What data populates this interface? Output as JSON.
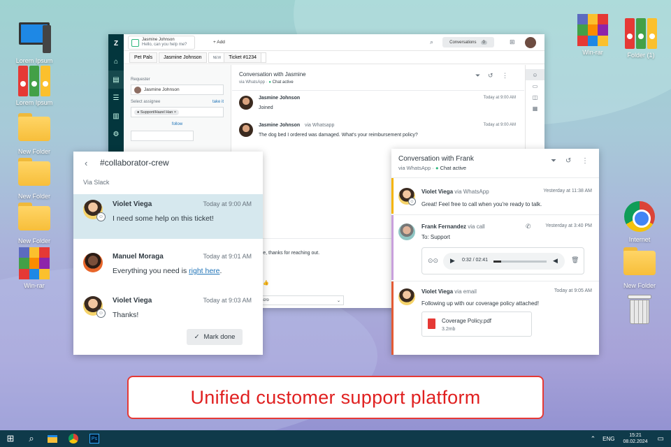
{
  "desktop": {
    "left_icons": [
      "Lorem Ipsum",
      "Lorem Ipsum",
      "New Folder",
      "New Folder",
      "New Folder",
      "Win-rar"
    ],
    "right_icons": [
      "Win-rar",
      "Folder (1)",
      "Internet",
      "New Folder"
    ]
  },
  "app": {
    "topbar": {
      "requester_name": "Jasmine Johnson",
      "requester_msg": "Hello, can you help me?",
      "add_label": "+ Add",
      "conversations_label": "Conversations",
      "conversations_count": "0"
    },
    "tabs": [
      "Pet Pals",
      "Jasmine Johnson"
    ],
    "ticket_tag": "NEW",
    "ticket_label": "Ticket #1234",
    "left": {
      "requester_label": "Requester",
      "requester_value": "Jasmine Johnson",
      "assignee_label": "Select assignee",
      "take_it": "take it",
      "assignee_value": "Support/Hazel Han",
      "follow": "follow"
    },
    "conversation": {
      "title": "Conversation with Jasmine",
      "via": "via WhatsApp",
      "status": "Chat active",
      "messages": [
        {
          "name": "Jasmine Johnson",
          "via": "",
          "time": "Today at 9:00 AM",
          "text": "Joined"
        },
        {
          "name": "Jasmine Johnson",
          "via": "via Whatsapp",
          "time": "Today at 9:00 AM",
          "text": "The dog bed I ordered was damaged. What's your reimbursement policy?"
        }
      ],
      "reply_fragment": "ere, thanks for reaching out.",
      "macro_fragment": "acro"
    }
  },
  "slack": {
    "channel": "#collaborator-crew",
    "via": "Via Slack",
    "messages": [
      {
        "name": "Violet Viega",
        "time": "Today at 9:00 AM",
        "text": "I need some help on this ticket!"
      },
      {
        "name": "Manuel Moraga",
        "time": "Today at 9:01 AM",
        "text_before": "Everything you need is ",
        "link": "right here",
        "text_after": "."
      },
      {
        "name": "Violet Viega",
        "time": "Today at 9:03 AM",
        "text": "Thanks!"
      }
    ],
    "mark_done": "Mark done"
  },
  "frank": {
    "title": "Conversation with Frank",
    "via": "via WhatsApp",
    "status": "Chat active",
    "items": [
      {
        "name": "Violet Viega",
        "via": "via WhatsApp",
        "time": "Yesterday at 11:38 AM",
        "text": "Great! Feel free to call when you're ready to talk."
      },
      {
        "name": "Frank Fernandez",
        "via": "via call",
        "time": "Yesterday at 3:40 PM",
        "text": "To: Support",
        "audio": "0:32 / 02:41"
      },
      {
        "name": "Violet Viega",
        "via": "via email",
        "time": "Today at 9:05 AM",
        "text": "Following up with our coverage policy attached!",
        "file_name": "Coverage Policy.pdf",
        "file_size": "3.2mb"
      }
    ]
  },
  "banner": "Unified customer support platform",
  "taskbar": {
    "lang": "ENG",
    "time": "15:21",
    "date": "08.02.2024"
  },
  "colors": {
    "accent": "#1f73b7",
    "banner_red": "#e02020",
    "green": "#2eb67d"
  }
}
